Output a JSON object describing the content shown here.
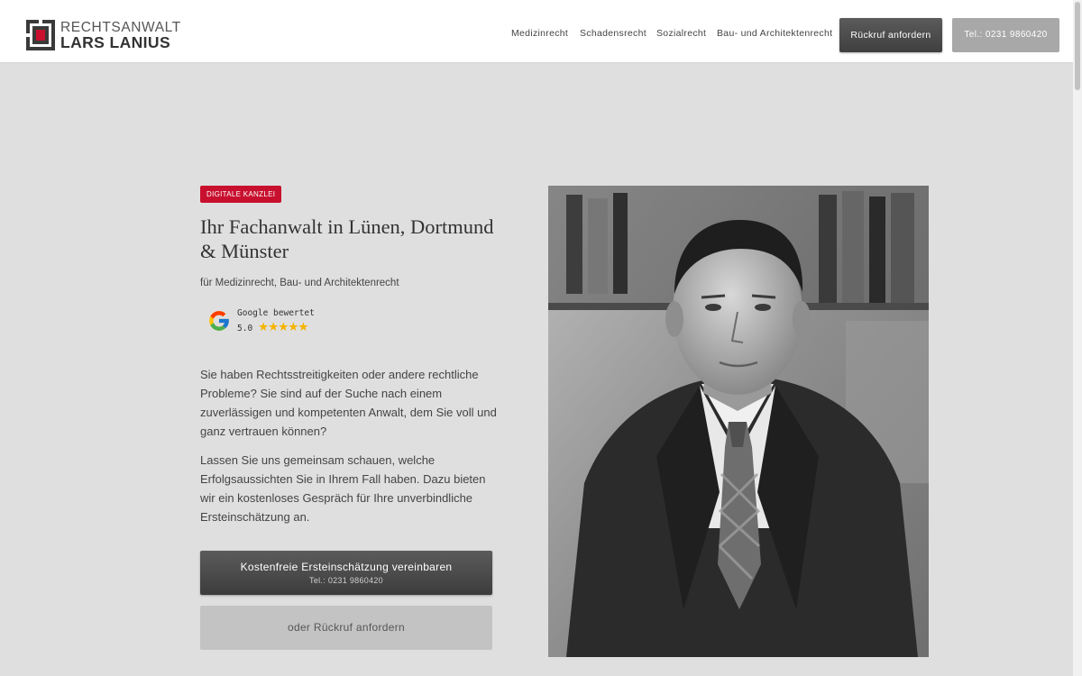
{
  "header": {
    "logo_line1": "RECHTSANWALT",
    "logo_line2": "LARS LANIUS",
    "nav": [
      "Medizinrecht",
      "Schadensrecht",
      "Sozialrecht",
      "Bau- und Architektenrecht"
    ],
    "callback_button": "Rückruf anfordern",
    "phone_button": "Tel.: 0231 9860420"
  },
  "hero": {
    "badge": "DIGITALE KANZLEI",
    "headline": "Ihr Fachanwalt in Lünen, Dortmund & Münster",
    "subline": "für Medizinrecht, Bau- und Architektenrecht",
    "google": {
      "label": "Google bewertet",
      "score": "5.0",
      "stars": "★★★★★",
      "rating": 5
    },
    "paragraph1": "Sie haben Rechtsstreitigkeiten oder andere rechtliche Probleme? Sie sind auf der Suche nach einem zuverlässigen und kompetenten Anwalt, dem Sie voll und ganz vertrauen können?",
    "paragraph2": "Lassen Sie uns gemeinsam schauen, welche Erfolgsaussichten Sie in Ihrem Fall haben. Dazu bieten wir ein kostenloses Gespräch für Ihre unverbindliche Ersteinschätzung an.",
    "cta_primary_title": "Kostenfreie Ersteinschätzung vereinbaren",
    "cta_primary_sub": "Tel.: 0231 9860420",
    "cta_secondary": "oder Rückruf anfordern"
  },
  "colors": {
    "accent_red": "#c8102e",
    "background": "#e0dfe0",
    "dark_button": "#4a4a4a",
    "light_button": "#a9a8a9",
    "star": "#f5b400"
  }
}
